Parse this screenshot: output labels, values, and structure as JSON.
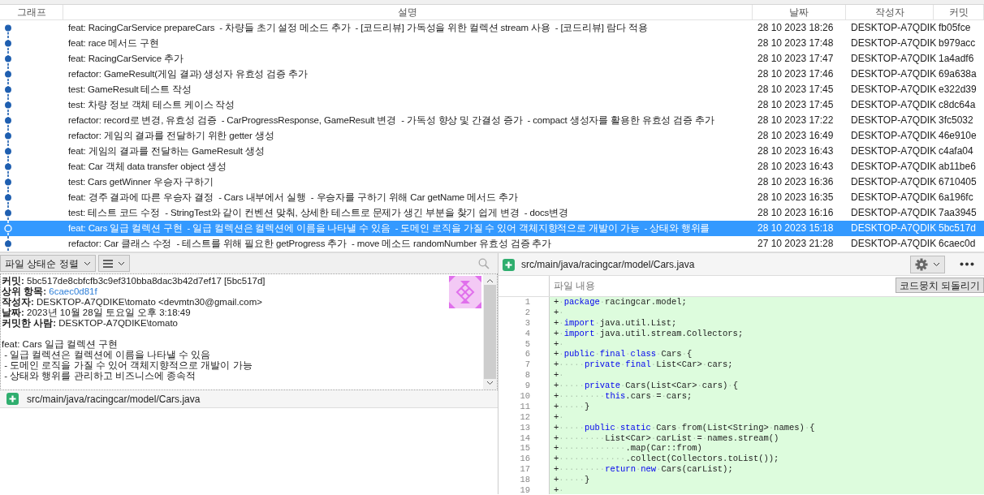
{
  "table": {
    "columns": [
      "그래프",
      "설명",
      "날짜",
      "작성자",
      "커밋"
    ],
    "rows": [
      {
        "description": "feat: RacingCarService prepareCars  - 차량들 초기 설정 메소드 추가  - [코드리뷰] 가독성을 위한 컬렉션 stream 사용  - [코드리뷰] 람다 적용",
        "date": "28 10 2023 18:26",
        "author": "DESKTOP-A7QDIK",
        "commit": "fb05fce",
        "selected": false
      },
      {
        "description": "feat: race 메서드 구현",
        "date": "28 10 2023 17:48",
        "author": "DESKTOP-A7QDIK",
        "commit": "b979acc",
        "selected": false
      },
      {
        "description": "feat: RacingCarService 추가",
        "date": "28 10 2023 17:47",
        "author": "DESKTOP-A7QDIK",
        "commit": "1a4adf6",
        "selected": false
      },
      {
        "description": "refactor: GameResult(게임 결과) 생성자 유효성 검증 추가",
        "date": "28 10 2023 17:46",
        "author": "DESKTOP-A7QDIK",
        "commit": "69a638a",
        "selected": false
      },
      {
        "description": "test: GameResult 테스트 작성",
        "date": "28 10 2023 17:45",
        "author": "DESKTOP-A7QDIK",
        "commit": "e322d39",
        "selected": false
      },
      {
        "description": "test: 차량 정보 객체 테스트 케이스 작성",
        "date": "28 10 2023 17:45",
        "author": "DESKTOP-A7QDIK",
        "commit": "c8dc64a",
        "selected": false
      },
      {
        "description": "refactor: record로 변경, 유효성 검증  - CarProgressResponse, GameResult 변경  - 가독성 향상 및 간결성 증가  - compact 생성자를 활용한 유효성 검증 추가",
        "date": "28 10 2023 17:22",
        "author": "DESKTOP-A7QDIK",
        "commit": "3fc5032",
        "selected": false
      },
      {
        "description": "refactor: 게임의 결과를 전달하기 위한 getter 생성",
        "date": "28 10 2023 16:49",
        "author": "DESKTOP-A7QDIK",
        "commit": "46e910e",
        "selected": false
      },
      {
        "description": "feat: 게임의 결과를 전달하는 GameResult 생성",
        "date": "28 10 2023 16:43",
        "author": "DESKTOP-A7QDIK",
        "commit": "c4afa04",
        "selected": false
      },
      {
        "description": "feat: Car 객체 data transfer object 생성",
        "date": "28 10 2023 16:43",
        "author": "DESKTOP-A7QDIK",
        "commit": "ab11be6",
        "selected": false
      },
      {
        "description": "test: Cars getWinner 우승자 구하기",
        "date": "28 10 2023 16:36",
        "author": "DESKTOP-A7QDIK",
        "commit": "6710405",
        "selected": false
      },
      {
        "description": "feat: 경주 결과에 따른 우승자 결정  - Cars 내부에서 실행  - 우승자를 구하기 위해 Car getName 메서드 추가",
        "date": "28 10 2023 16:35",
        "author": "DESKTOP-A7QDIK",
        "commit": "6a196fc",
        "selected": false
      },
      {
        "description": "test: 테스트 코드 수정  - StringTest와 같이 컨벤션 맞춰, 상세한 테스트로 문제가 생긴 부분을 찾기 쉽게 변경  - docs변경",
        "date": "28 10 2023 16:16",
        "author": "DESKTOP-A7QDIK",
        "commit": "7aa3945",
        "selected": false
      },
      {
        "description": "feat: Cars 일급 컬렉션 구현  - 일급 컬렉션은 컬렉션에 이름을 나타낼 수 있음  - 도메인 로직을 가질 수 있어 객체지향적으로 개발이 가능  - 상태와 행위를",
        "date": "28 10 2023 15:18",
        "author": "DESKTOP-A7QDIK",
        "commit": "5bc517d",
        "selected": true
      },
      {
        "description": "refactor: Car 클래스 수정  - 테스트를 위해 필요한 getProgress 추가  - move 메소드 randomNumber 유효성 검증 추가",
        "date": "27 10 2023 21:28",
        "author": "DESKTOP-A7QDIK",
        "commit": "6caec0d",
        "selected": false
      }
    ]
  },
  "file_list": {
    "sort_button": "파일 상태순 정렬",
    "files": [
      {
        "path": "src/main/java/racingcar/model/Cars.java",
        "kind": "added"
      }
    ]
  },
  "commit_details": {
    "fields": [
      {
        "label": "커밋:",
        "value": "5bc517de8cbfcfb3c9ef310bba8dac3b42d7ef17 [5bc517d]",
        "kind": "text"
      },
      {
        "label": "상위 항목:",
        "value": "6caec0d81f",
        "kind": "link"
      },
      {
        "label": "작성자:",
        "value": "DESKTOP-A7QDIKE\\tomato <devmtn30@gmail.com>",
        "kind": "text"
      },
      {
        "label": "날짜:",
        "value": "2023년 10월 28일 토요일 오후 3:18:49",
        "kind": "text"
      },
      {
        "label": "커밋한 사람:",
        "value": "DESKTOP-A7QDIKE\\tomato",
        "kind": "text"
      }
    ],
    "message": [
      "feat: Cars 일급 컬렉션 구현",
      " - 일급 컬렉션은 컬렉션에 이름을 나타낼 수 있음",
      " - 도메인 로직을 가질 수 있어 객체지향적으로 개발이 가능",
      " - 상태와 행위를 관리하고 비즈니스에 종속적"
    ]
  },
  "diff": {
    "file": {
      "path": "src/main/java/racingcar/model/Cars.java",
      "kind": "added"
    },
    "column_header": "파일 내용",
    "revert_button": "코드뭉치 되돌리기",
    "lines": [
      {
        "number": "1",
        "segments": [
          {
            "kind": "text",
            "text": "+·"
          },
          {
            "kind": "keyword",
            "text": "package"
          },
          {
            "kind": "text",
            "text": "·racingcar.model;"
          }
        ]
      },
      {
        "number": "2",
        "segments": [
          {
            "kind": "text",
            "text": "+·"
          }
        ]
      },
      {
        "number": "3",
        "segments": [
          {
            "kind": "text",
            "text": "+·"
          },
          {
            "kind": "keyword",
            "text": "import"
          },
          {
            "kind": "text",
            "text": "·java.util.List;"
          }
        ]
      },
      {
        "number": "4",
        "segments": [
          {
            "kind": "text",
            "text": "+·"
          },
          {
            "kind": "keyword",
            "text": "import"
          },
          {
            "kind": "text",
            "text": "·java.util.stream.Collectors;"
          }
        ]
      },
      {
        "number": "5",
        "segments": [
          {
            "kind": "text",
            "text": "+·"
          }
        ]
      },
      {
        "number": "6",
        "segments": [
          {
            "kind": "text",
            "text": "+·"
          },
          {
            "kind": "keyword",
            "text": "public"
          },
          {
            "kind": "text",
            "text": "·"
          },
          {
            "kind": "keyword",
            "text": "final"
          },
          {
            "kind": "text",
            "text": "·"
          },
          {
            "kind": "keyword",
            "text": "class"
          },
          {
            "kind": "text",
            "text": "·Cars·{"
          }
        ]
      },
      {
        "number": "7",
        "segments": [
          {
            "kind": "text",
            "text": "+·····"
          },
          {
            "kind": "keyword",
            "text": "private"
          },
          {
            "kind": "text",
            "text": "·"
          },
          {
            "kind": "keyword",
            "text": "final"
          },
          {
            "kind": "text",
            "text": "·List<Car>·cars;"
          }
        ]
      },
      {
        "number": "8",
        "segments": [
          {
            "kind": "text",
            "text": "+·"
          }
        ]
      },
      {
        "number": "9",
        "segments": [
          {
            "kind": "text",
            "text": "+·····"
          },
          {
            "kind": "keyword",
            "text": "private"
          },
          {
            "kind": "text",
            "text": "·Cars(List<Car>·cars)·{"
          }
        ]
      },
      {
        "number": "10",
        "segments": [
          {
            "kind": "text",
            "text": "+·········"
          },
          {
            "kind": "keyword",
            "text": "this"
          },
          {
            "kind": "text",
            "text": ".cars·=·cars;"
          }
        ]
      },
      {
        "number": "11",
        "segments": [
          {
            "kind": "text",
            "text": "+·····}"
          }
        ]
      },
      {
        "number": "12",
        "segments": [
          {
            "kind": "text",
            "text": "+·"
          }
        ]
      },
      {
        "number": "13",
        "segments": [
          {
            "kind": "text",
            "text": "+·····"
          },
          {
            "kind": "keyword",
            "text": "public"
          },
          {
            "kind": "text",
            "text": "·"
          },
          {
            "kind": "keyword",
            "text": "static"
          },
          {
            "kind": "text",
            "text": "·Cars·from(List<String>·names)·{"
          }
        ]
      },
      {
        "number": "14",
        "segments": [
          {
            "kind": "text",
            "text": "+·········List<Car>·carList·=·names.stream()"
          }
        ]
      },
      {
        "number": "15",
        "segments": [
          {
            "kind": "text",
            "text": "+·············.map(Car::from)"
          }
        ]
      },
      {
        "number": "16",
        "segments": [
          {
            "kind": "text",
            "text": "+·············.collect(Collectors.toList());"
          }
        ]
      },
      {
        "number": "17",
        "segments": [
          {
            "kind": "text",
            "text": "+·········"
          },
          {
            "kind": "keyword",
            "text": "return"
          },
          {
            "kind": "text",
            "text": "·"
          },
          {
            "kind": "keyword",
            "text": "new"
          },
          {
            "kind": "text",
            "text": "·Cars(carList);"
          }
        ]
      },
      {
        "number": "18",
        "segments": [
          {
            "kind": "text",
            "text": "+·····}"
          }
        ]
      },
      {
        "number": "19",
        "segments": [
          {
            "kind": "text",
            "text": "+·"
          }
        ]
      }
    ]
  }
}
